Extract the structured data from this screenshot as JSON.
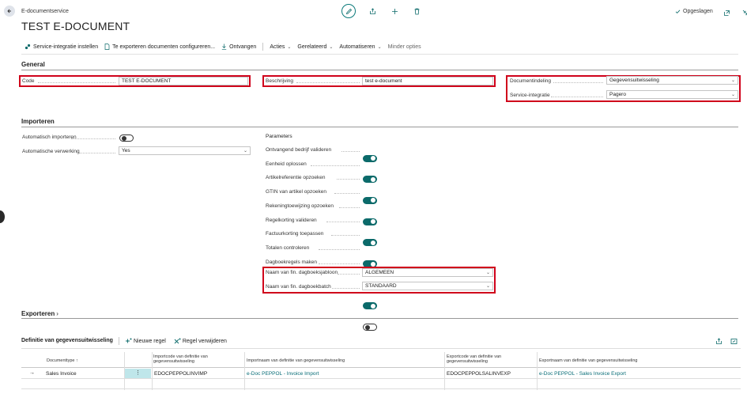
{
  "header": {
    "breadcrumb": "E-documentservice",
    "title": "TEST E-DOCUMENT",
    "saved_label": "Opgeslagen"
  },
  "actions": {
    "service_setup": "Service-integratie instellen",
    "export_docs": "Te exporteren documenten configureren...",
    "receive": "Ontvangen",
    "acties": "Acties",
    "gerelateerd": "Gerelateerd",
    "automatiseren": "Automatiseren",
    "minder_opties": "Minder opties"
  },
  "general": {
    "title": "General",
    "code_label": "Code",
    "code_value": "TEST E-DOCUMENT",
    "beschrijving_label": "Beschrijving",
    "beschrijving_value": "test e-document",
    "documentindeling_label": "Documentindeling",
    "documentindeling_value": "Gegevensuitwisseling",
    "service_integratie_label": "Service-integratie",
    "service_integratie_value": "Pagero"
  },
  "importeren": {
    "title": "Importeren",
    "auto_import_label": "Automatisch importeren",
    "auto_import_value": false,
    "auto_verwerking_label": "Automatische verwerking",
    "auto_verwerking_value": "Yes",
    "parameters_title": "Parameters",
    "parameters": [
      {
        "label": "Ontvangend bedrijf valideren",
        "on": true
      },
      {
        "label": "Eenheid oplossen",
        "on": true
      },
      {
        "label": "Artikelreferentie opzoeken",
        "on": true
      },
      {
        "label": "GTIN van artikel opzoeken",
        "on": true
      },
      {
        "label": "Rekeningtoewijzing opzoeken",
        "on": true
      },
      {
        "label": "Regelkorting valideren",
        "on": true
      },
      {
        "label": "Factuurkorting toepassen",
        "on": true
      },
      {
        "label": "Totalen controleren",
        "on": true
      },
      {
        "label": "Dagboekregels maken",
        "on": false
      }
    ],
    "journal_template_label": "Naam van fin. dagboeksjabloon",
    "journal_template_value": "ALGEMEEN",
    "journal_batch_label": "Naam van fin. dagboekbatch",
    "journal_batch_value": "STANDAARD"
  },
  "exporteren": {
    "title": "Exporteren"
  },
  "subpage": {
    "title": "Definitie van gegevensuitwisseling",
    "new_line": "Nieuwe regel",
    "delete_line": "Regel verwijderen",
    "columns": {
      "doctype": "Documenttype ↑",
      "import_code": "Importcode van definitie van gegevensuitwisseling",
      "import_name": "Importnaam van definitie van gegevensuitwisseling",
      "export_code": "Exportcode van definitie van gegevensuitwisseling",
      "export_name": "Exportnaam van definitie van gegevensuitwisseling"
    },
    "row": {
      "doctype": "Sales Invoice",
      "import_code": "EDOCPEPPOLINVIMP",
      "import_name": "e-Doc PEPPOL - Invoice Import",
      "export_code": "EDOCPEPPOLSALINVEXP",
      "export_name": "e-Doc PEPPOL - Sales Invoice Export"
    }
  },
  "colors": {
    "accent": "#0b6a6a",
    "highlight": "#d0021b",
    "link": "#0a6e78"
  }
}
